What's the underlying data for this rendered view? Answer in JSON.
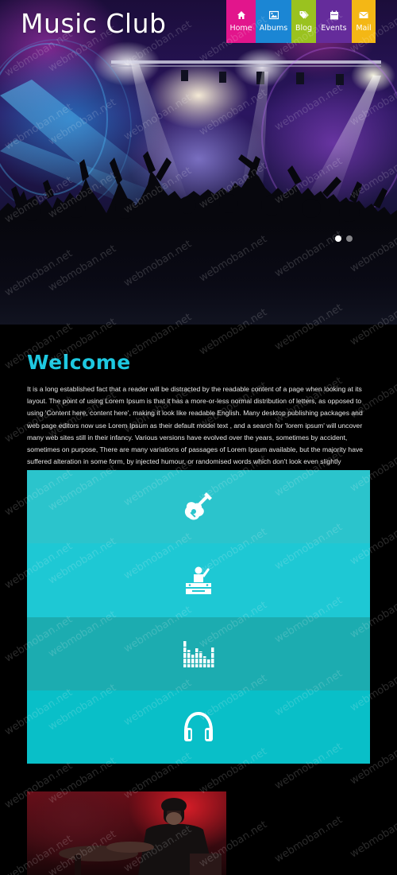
{
  "site": {
    "logo": "Music Club"
  },
  "nav": {
    "items": [
      {
        "label": "Home",
        "icon": "home-icon",
        "color": "#e2158c"
      },
      {
        "label": "Albums",
        "icon": "image-icon",
        "color": "#1b86d4"
      },
      {
        "label": "Blog",
        "icon": "tags-icon",
        "color": "#9ac21f"
      },
      {
        "label": "Events",
        "icon": "calendar-icon",
        "color": "#652c9b"
      },
      {
        "label": "Mail",
        "icon": "envelope-icon",
        "color": "#f4b715"
      }
    ]
  },
  "slider": {
    "slide_count": 2,
    "active_index": 0
  },
  "welcome": {
    "title": "Welcome",
    "text": "It is a long established fact that a reader will be distracted by the readable content of a page when looking at its layout. The point of using Lorem Ipsum is that it has a more-or-less normal distribution of letters, as opposed to using 'Content here, content here', making it look like readable English. Many desktop publishing packages and web page editors now use Lorem Ipsum as their default model text , and a search for 'lorem ipsum' will uncover many web sites still in their infancy. Various versions have evolved over the years, sometimes by accident, sometimes on purpose, There are many variations of passages of Lorem Ipsum available, but the majority have suffered alteration in some form, by injected humour, or randomised words which don't look even slightly believable. If you are going to"
  },
  "tiles": [
    {
      "icon": "guitar-icon",
      "color": "#2bc4cc"
    },
    {
      "icon": "dj-icon",
      "color": "#1ec8d4"
    },
    {
      "icon": "equalizer-icon",
      "color": "#1cacb0"
    },
    {
      "icon": "headphones-icon",
      "color": "#09bfc8"
    }
  ],
  "watermark": "webmoban.net",
  "colors": {
    "accent": "#1ec8e0",
    "background": "#000000"
  }
}
